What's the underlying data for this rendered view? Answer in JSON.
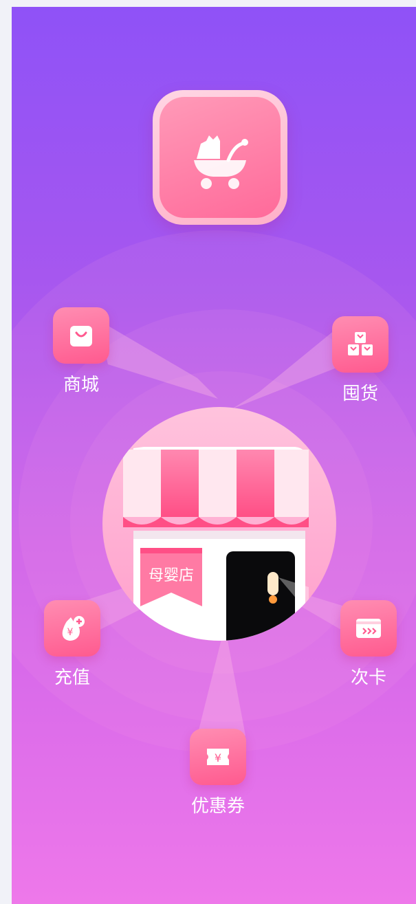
{
  "app": {
    "icon": "stroller-icon"
  },
  "store": {
    "sign_text": "母婴店"
  },
  "features": [
    {
      "label": "商城",
      "icon": "shopping-bag-icon"
    },
    {
      "label": "囤货",
      "icon": "boxes-icon"
    },
    {
      "label": "充值",
      "icon": "money-bag-plus-icon"
    },
    {
      "label": "次卡",
      "icon": "card-icon"
    },
    {
      "label": "优惠券",
      "icon": "coupon-icon"
    }
  ],
  "colors": {
    "background_top": "#8f52f7",
    "background_bottom": "#ee78ea",
    "tile": "#ff6a9a",
    "accent_pink": "#ff5a8f"
  }
}
